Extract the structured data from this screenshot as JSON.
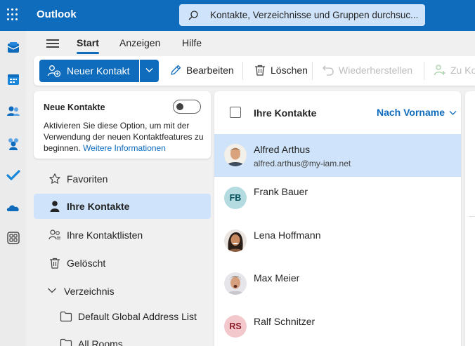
{
  "app": {
    "title": "Outlook"
  },
  "search": {
    "placeholder": "Kontakte, Verzeichnisse und Gruppen durchsuc..."
  },
  "rail": [
    {
      "icon": "mail-icon"
    },
    {
      "icon": "calendar-icon"
    },
    {
      "icon": "people-icon"
    },
    {
      "icon": "groups-icon"
    },
    {
      "icon": "todo-icon"
    },
    {
      "icon": "onedrive-icon"
    },
    {
      "icon": "apps-icon"
    }
  ],
  "tabs": [
    {
      "label": "Start",
      "active": true
    },
    {
      "label": "Anzeigen",
      "active": false
    },
    {
      "label": "Hilfe",
      "active": false
    }
  ],
  "toolbar": {
    "new_contact": "Neuer Kontakt",
    "edit": "Bearbeiten",
    "delete": "Löschen",
    "restore": "Wiederherstellen",
    "add_to": "Zu Ko"
  },
  "new_contacts": {
    "title": "Neue Kontakte",
    "description": "Aktivieren Sie diese Option, um mit der Verwendung der neuen Kontaktfeatures zu beginnen.",
    "link": "Weitere Informationen",
    "enabled": false
  },
  "nav": [
    {
      "label": "Favoriten",
      "icon": "star-icon"
    },
    {
      "label": "Ihre Kontakte",
      "icon": "person-icon",
      "selected": true
    },
    {
      "label": "Ihre Kontaktlisten",
      "icon": "contact-list-icon"
    },
    {
      "label": "Gelöscht",
      "icon": "trash-icon"
    },
    {
      "label": "Verzeichnis",
      "icon": "chevron-down-icon"
    },
    {
      "label": "Default Global Address List",
      "icon": "folder-icon"
    },
    {
      "label": "All Rooms",
      "icon": "folder-icon"
    }
  ],
  "list": {
    "title": "Ihre Kontakte",
    "sort": "Nach Vorname",
    "contacts": [
      {
        "name": "Alfred Arthus",
        "email": "alfred.arthus@my-iam.net",
        "selected": true,
        "avatar_type": "photo"
      },
      {
        "name": "Frank Bauer",
        "initials": "FB",
        "avatar_type": "initials",
        "bg": "#b3dbe0",
        "fg": "#004e59"
      },
      {
        "name": "Lena Hoffmann",
        "avatar_type": "photo"
      },
      {
        "name": "Max Meier",
        "avatar_type": "photo"
      },
      {
        "name": "Ralf Schnitzer",
        "initials": "RS",
        "avatar_type": "initials",
        "bg": "#f3c8cc",
        "fg": "#8a1c27"
      }
    ]
  },
  "colors": {
    "brand": "#0f6cbd",
    "selected": "#cfe4fa"
  }
}
